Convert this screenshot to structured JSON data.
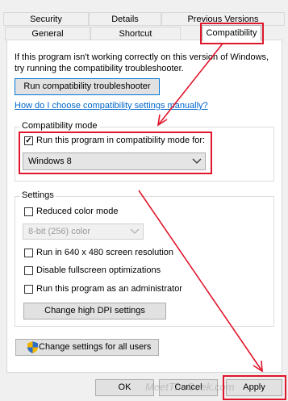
{
  "tabs": {
    "row1": [
      "Security",
      "Details",
      "Previous Versions"
    ],
    "row2": [
      "General",
      "Shortcut",
      "Compatibility"
    ]
  },
  "intro": {
    "line1": "If this program isn't working correctly on this version of Windows,",
    "line2": "try running the compatibility troubleshooter."
  },
  "troubleshooter_button": "Run compatibility troubleshooter",
  "help_link": "How do I choose compatibility settings manually?",
  "compat_mode": {
    "group_label": "Compatibility mode",
    "checkbox_label": "Run this program in compatibility mode for:",
    "checked": true,
    "selected_os": "Windows 8"
  },
  "settings": {
    "group_label": "Settings",
    "reduced_color_label": "Reduced color mode",
    "color_select_value": "8-bit (256) color",
    "resolution_label": "Run in 640 x 480 screen resolution",
    "fullscreen_label": "Disable fullscreen optimizations",
    "admin_label": "Run this program as an administrator",
    "dpi_button": "Change high DPI settings"
  },
  "all_users_button": "Change settings for all users",
  "footer": {
    "ok": "OK",
    "cancel": "Cancel",
    "apply": "Apply"
  },
  "watermark": "MeetTheGeek.com",
  "colors": {
    "annotation_red": "#e0162c",
    "link_blue": "#0066cc",
    "focus_blue": "#0078d7",
    "shield_blue": "#2f6fc9",
    "shield_gold": "#f0b400"
  }
}
